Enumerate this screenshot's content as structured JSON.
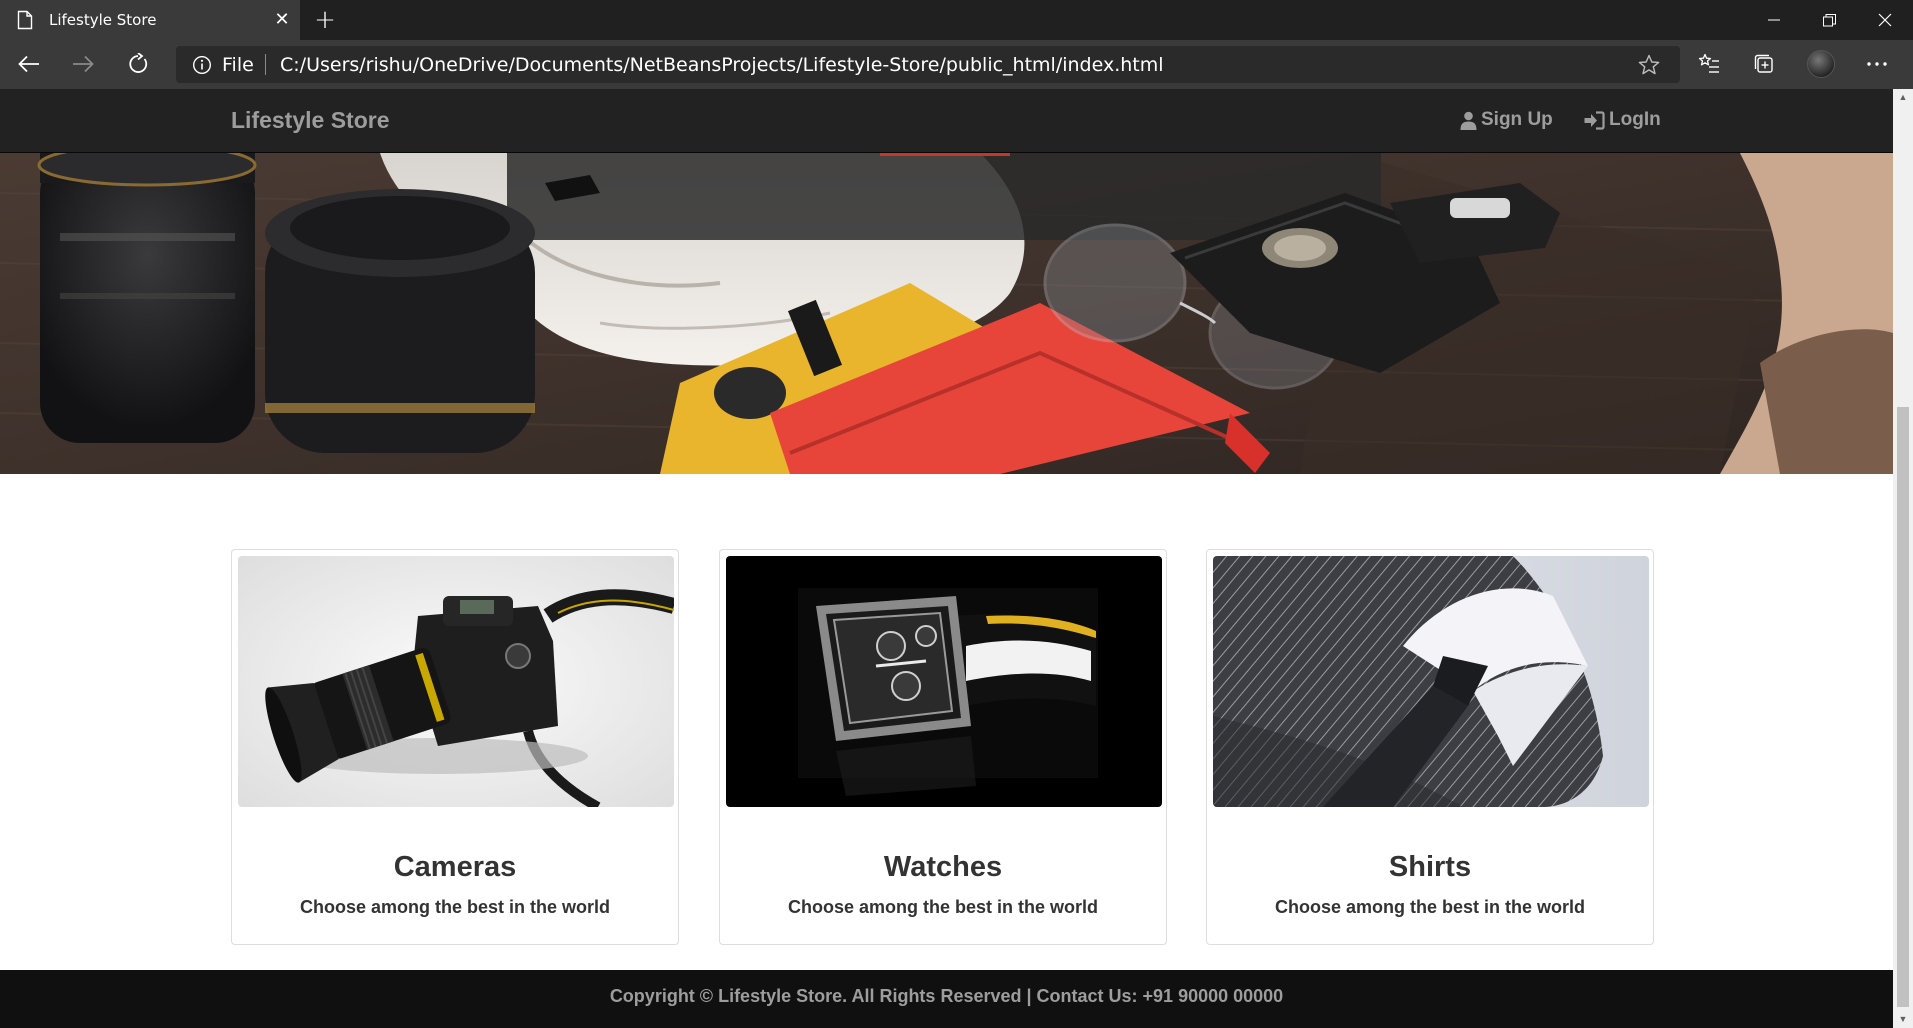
{
  "browser": {
    "tab_title": "Lifestyle Store",
    "address_prefix": "File",
    "url": "C:/Users/rishu/OneDrive/Documents/NetBeansProjects/Lifestyle-Store/public_html/index.html"
  },
  "site": {
    "brand": "Lifestyle Store",
    "nav": {
      "signup_label": "Sign Up",
      "login_label": "LogIn"
    }
  },
  "categories": [
    {
      "title": "Cameras",
      "subtitle": "Choose among the best in the world"
    },
    {
      "title": "Watches",
      "subtitle": "Choose among the best in the world"
    },
    {
      "title": "Shirts",
      "subtitle": "Choose among the best in the world"
    }
  ],
  "footer": {
    "text": "Copyright © Lifestyle Store. All Rights Reserved | Contact Us: +91 90000 00000"
  },
  "colors": {
    "navbar": "#222222",
    "brand_text": "#9d9d9d",
    "footer": "#101010",
    "browser_chrome": "#3a3a3a"
  }
}
